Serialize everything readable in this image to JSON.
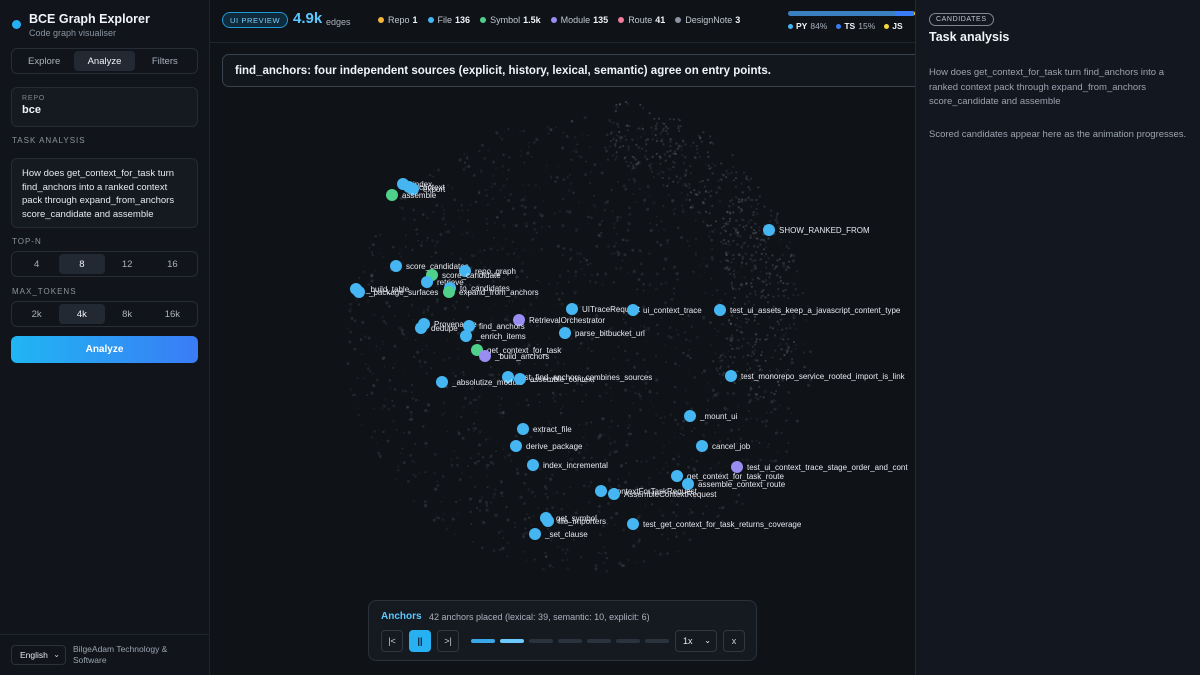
{
  "app": {
    "title": "BCE Graph Explorer",
    "subtitle": "Code graph visualiser"
  },
  "tabs": [
    {
      "label": "Explore",
      "active": false
    },
    {
      "label": "Analyze",
      "active": true
    },
    {
      "label": "Filters",
      "active": false
    }
  ],
  "repo": {
    "label": "REPO",
    "value": "bce"
  },
  "task": {
    "section_label": "TASK ANALYSIS",
    "query": "How does get_context_for_task turn find_anchors into a ranked context pack through expand_from_anchors score_candidate and assemble"
  },
  "top_n": {
    "label": "TOP-N",
    "options": [
      "4",
      "8",
      "12",
      "16"
    ],
    "selected": "8"
  },
  "max_tokens": {
    "label": "MAX_TOKENS",
    "options": [
      "2k",
      "4k",
      "8k",
      "16k"
    ],
    "selected": "4k"
  },
  "analyze_button": "Analyze",
  "footer": {
    "language": "English",
    "company": "BilgeAdam Technology & Software"
  },
  "topbar": {
    "badge": "UI PREVIEW",
    "edge_count": "4.9k",
    "edge_label": "edges",
    "legend": [
      {
        "label": "Repo",
        "count": "1",
        "color": "#f5b43b"
      },
      {
        "label": "File",
        "count": "136",
        "color": "#45b6f2"
      },
      {
        "label": "Symbol",
        "count": "1.5k",
        "color": "#4fd18b"
      },
      {
        "label": "Module",
        "count": "135",
        "color": "#9b8cf2"
      },
      {
        "label": "Route",
        "count": "41",
        "color": "#f27a9a"
      },
      {
        "label": "DesignNote",
        "count": "3",
        "color": "#8a93a0"
      }
    ],
    "languages": [
      {
        "name": "PY",
        "pct": "84%",
        "color": "#45b6f2",
        "share": 0.84
      },
      {
        "name": "TS",
        "pct": "15%",
        "color": "#3a7cf5",
        "share": 0.15
      },
      {
        "name": "JS",
        "pct": "",
        "color": "#f5d83b",
        "share": 0.01
      }
    ]
  },
  "banner": "find_anchors: four independent sources (explicit, history, lexical, semantic) agree on entry points.",
  "graph": {
    "nodes": [
      {
        "label": "index",
        "type": "file"
      },
      {
        "label": "context",
        "type": "file"
      },
      {
        "label": "export",
        "type": "file"
      },
      {
        "label": "assemble",
        "type": "symbol"
      },
      {
        "label": "SHOW_RANKED_FROM",
        "type": "file"
      },
      {
        "label": "score_candidates",
        "type": "file"
      },
      {
        "label": "repo_graph",
        "type": "file"
      },
      {
        "label": "score_candidate",
        "type": "symbol"
      },
      {
        "label": "retrieve",
        "type": "file"
      },
      {
        "label": "_build_table",
        "type": "file"
      },
      {
        "label": "to_candidates",
        "type": "file"
      },
      {
        "label": "_package_surfaces",
        "type": "file"
      },
      {
        "label": "expand_from_anchors",
        "type": "symbol"
      },
      {
        "label": "UITraceRequest",
        "type": "file"
      },
      {
        "label": "ui_context_trace",
        "type": "file"
      },
      {
        "label": "test_ui_assets_keep_a_javascript_content_type",
        "type": "file"
      },
      {
        "label": "RetrievalOrchestrator",
        "type": "module"
      },
      {
        "label": "Provenance",
        "type": "file"
      },
      {
        "label": "find_anchors",
        "type": "file"
      },
      {
        "label": "dedupe",
        "type": "file"
      },
      {
        "label": "_enrich_items",
        "type": "file"
      },
      {
        "label": "parse_bitbucket_url",
        "type": "file"
      },
      {
        "label": "get_context_for_task",
        "type": "symbol"
      },
      {
        "label": "_build_anchors",
        "type": "module"
      },
      {
        "label": "test_find_anchors_combines_sources",
        "type": "file"
      },
      {
        "label": "_absolutize_module",
        "type": "file"
      },
      {
        "label": "assemble_context",
        "type": "file"
      },
      {
        "label": "test_monorepo_service_rooted_import_is_link",
        "type": "file"
      },
      {
        "label": "_mount_ui",
        "type": "file"
      },
      {
        "label": "extract_file",
        "type": "file"
      },
      {
        "label": "derive_package",
        "type": "file"
      },
      {
        "label": "cancel_job",
        "type": "file"
      },
      {
        "label": "index_incremental",
        "type": "file"
      },
      {
        "label": "test_ui_context_trace_stage_order_and_cont",
        "type": "module"
      },
      {
        "label": "get_context_for_task_route",
        "type": "file"
      },
      {
        "label": "assemble_context_route",
        "type": "file"
      },
      {
        "label": "ContextForTaskRequest",
        "type": "file"
      },
      {
        "label": "AssembleContextRequest",
        "type": "file"
      },
      {
        "label": "get_symbol",
        "type": "file"
      },
      {
        "label": "file_importers",
        "type": "file"
      },
      {
        "label": "test_get_context_for_task_returns_coverage",
        "type": "file"
      },
      {
        "label": "_set_clause",
        "type": "file"
      }
    ]
  },
  "right_panel": {
    "badge": "CANDIDATES",
    "title": "Task analysis",
    "query": "How does get_context_for_task turn find_anchors into a ranked context pack through expand_from_anchors score_candidate and assemble",
    "note": "Scored candidates appear here as the animation progresses."
  },
  "anchors": {
    "title": "Anchors",
    "info": "42 anchors placed (lexical: 39, semantic: 10, explicit: 6)",
    "first_icon": "|<",
    "pause_icon": "||",
    "last_icon": ">|",
    "progress_steps": 7,
    "progress_step": 2,
    "speed": "1x",
    "close": "x"
  },
  "colors": {
    "file": "#45b6f2",
    "symbol": "#4fd18b",
    "module": "#9b8cf2"
  }
}
